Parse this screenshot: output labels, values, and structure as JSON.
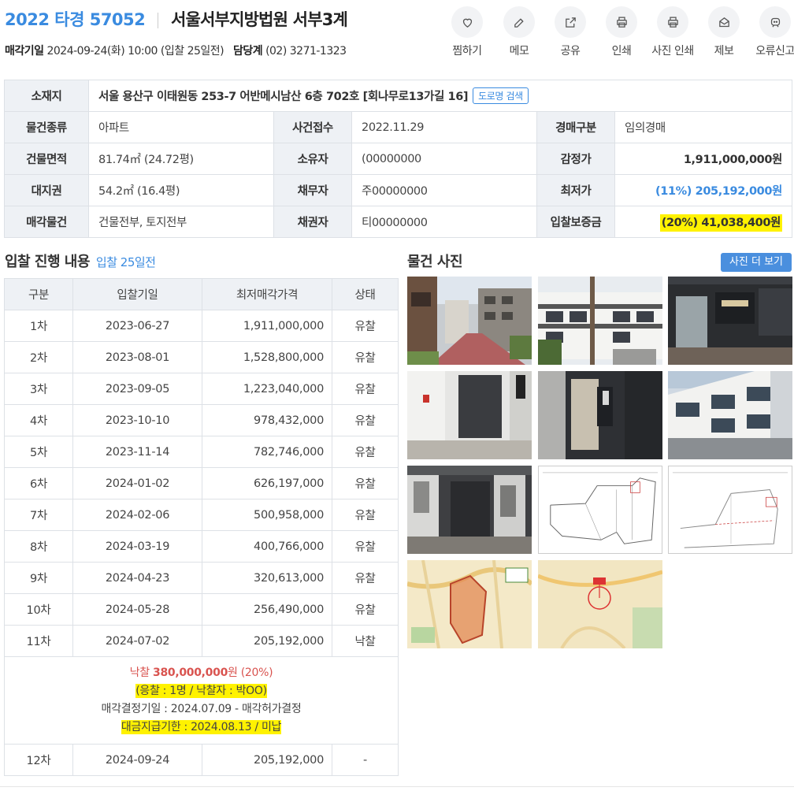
{
  "header": {
    "case_no": "2022 타경 57052",
    "court": "서울서부지방법원 서부3계",
    "sale_date_label": "매각기일",
    "sale_date": "2024-09-24(화) 10:00 (입찰 25일전)",
    "dept_label": "담당계",
    "dept_phone": "(02) 3271-1323"
  },
  "actions": [
    {
      "label": "찜하기",
      "icon": "heart-icon"
    },
    {
      "label": "메모",
      "icon": "edit-icon"
    },
    {
      "label": "공유",
      "icon": "share-icon"
    },
    {
      "label": "인쇄",
      "icon": "print-icon"
    },
    {
      "label": "사진 인쇄",
      "icon": "print-icon"
    },
    {
      "label": "제보",
      "icon": "mail-icon"
    },
    {
      "label": "오류신고",
      "icon": "alert-icon"
    }
  ],
  "info": {
    "location_label": "소재지",
    "location": "서울 용산구 이태원동 253-7 어반메시남산 6층 702호 [회나무로13가길 16]",
    "road_search": "도로명 검색",
    "type_label": "물건종류",
    "type": "아파트",
    "receipt_label": "사건접수",
    "receipt": "2022.11.29",
    "auction_label": "경매구분",
    "auction": "임의경매",
    "area_label": "건물면적",
    "area": "81.74㎡ (24.72평)",
    "owner_label": "소유자",
    "owner": "(00000000",
    "appraisal_label": "감정가",
    "appraisal": "1,911,000,000원",
    "land_label": "대지권",
    "land": "54.2㎡ (16.4평)",
    "debtor_label": "채무자",
    "debtor": "주00000000",
    "min_label": "최저가",
    "min": "(11%) 205,192,000원",
    "sale_items_label": "매각물건",
    "sale_items": "건물전부, 토지전부",
    "creditor_label": "채권자",
    "creditor": "티00000000",
    "deposit_label": "입찰보증금",
    "deposit": "(20%) 41,038,400원"
  },
  "bidding": {
    "title": "입찰 진행 내용",
    "sub": "입찰 25일전",
    "headers": [
      "구분",
      "입찰기일",
      "최저매각가격",
      "상태"
    ],
    "rows": [
      [
        "1차",
        "2023-06-27",
        "1,911,000,000",
        "유찰"
      ],
      [
        "2차",
        "2023-08-01",
        "1,528,800,000",
        "유찰"
      ],
      [
        "3차",
        "2023-09-05",
        "1,223,040,000",
        "유찰"
      ],
      [
        "4차",
        "2023-10-10",
        "978,432,000",
        "유찰"
      ],
      [
        "5차",
        "2023-11-14",
        "782,746,000",
        "유찰"
      ],
      [
        "6차",
        "2024-01-02",
        "626,197,000",
        "유찰"
      ],
      [
        "7차",
        "2024-02-06",
        "500,958,000",
        "유찰"
      ],
      [
        "8차",
        "2024-03-19",
        "400,766,000",
        "유찰"
      ],
      [
        "9차",
        "2024-04-23",
        "320,613,000",
        "유찰"
      ],
      [
        "10차",
        "2024-05-28",
        "256,490,000",
        "유찰"
      ],
      [
        "11차",
        "2024-07-02",
        "205,192,000",
        "낙찰"
      ]
    ],
    "sold": {
      "label": "낙찰",
      "amount": "380,000,000",
      "unit": "원",
      "pct": "(20%)",
      "bidders": "(응찰 : 1명 / 낙찰자 : 박OO)",
      "decision": "매각결정기일 : 2024.07.09 - 매각허가결정",
      "payment": "대금지급기한 : 2024.08.13 / 미납"
    },
    "last_row": [
      "12차",
      "2024-09-24",
      "205,192,000",
      "-"
    ]
  },
  "photos": {
    "title": "물건 사진",
    "more": "사진 더 보기"
  },
  "colors": {
    "accent": "#3a8be0",
    "highlight": "#fff200",
    "sold_red": "#d9534f",
    "header_bg": "#eef1f5"
  }
}
